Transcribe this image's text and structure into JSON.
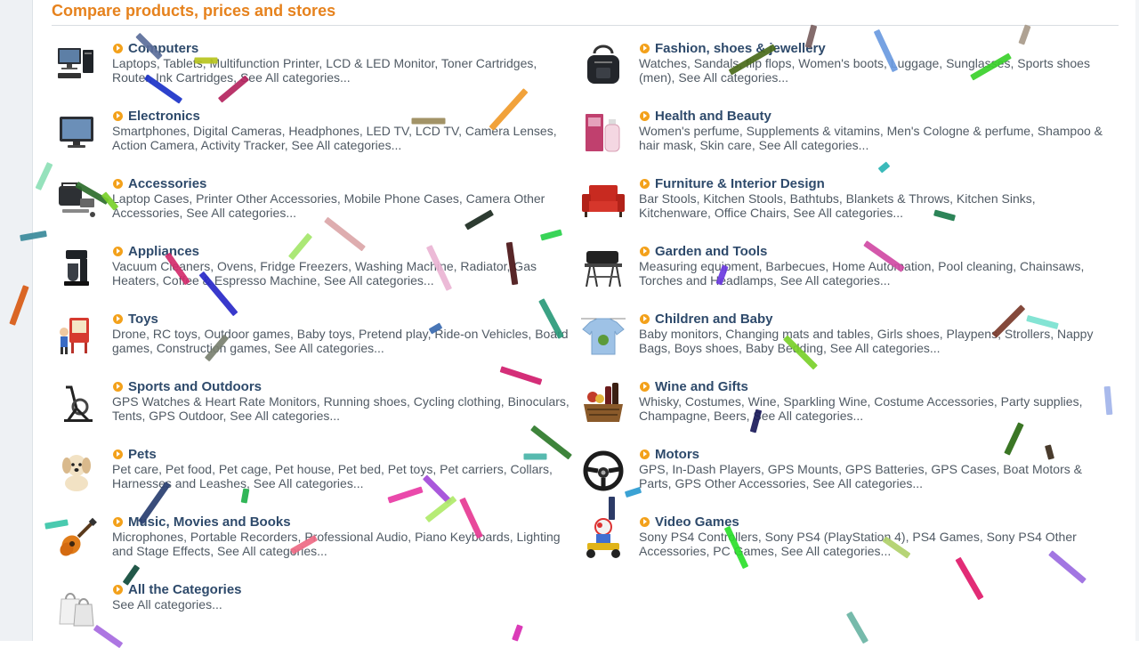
{
  "heading": "Compare products, prices and stores",
  "categories_left": [
    {
      "title": "Computers",
      "links": "Laptops, Tablets, Multifunction Printer, LCD & LED Monitor, Toner Cartridges, Router, Ink Cartridges, See All categories...",
      "icon": "computer-icon"
    },
    {
      "title": "Electronics",
      "links": "Smartphones, Digital Cameras, Headphones, LED TV, LCD TV, Camera Lenses, Action Camera, Activity Tracker, See All categories...",
      "icon": "tv-icon"
    },
    {
      "title": "Accessories",
      "links": "Laptop Cases, Printer Other Accessories, Mobile Phone Cases, Camera Other Accessories, See All categories...",
      "icon": "bag-accessories-icon"
    },
    {
      "title": "Appliances",
      "links": "Vacuum Cleaners, Ovens, Fridge Freezers, Washing Machine, Radiator, Gas Heaters, Coffee & Espresso Machine, See All categories...",
      "icon": "coffee-maker-icon"
    },
    {
      "title": "Toys",
      "links": "Drone, RC toys, Outdoor games, Baby toys, Pretend play, Ride-on Vehicles, Board games, Construction games, See All categories...",
      "icon": "toy-easel-icon"
    },
    {
      "title": "Sports and Outdoors",
      "links": "GPS Watches & Heart Rate Monitors, Running shoes, Cycling clothing, Binoculars, Tents, GPS Outdoor, See All categories...",
      "icon": "exercise-bike-icon"
    },
    {
      "title": "Pets",
      "links": "Pet care, Pet food, Pet cage, Pet house, Pet bed, Pet toys, Pet carriers, Collars, Harnesses and Leashes, See All categories...",
      "icon": "puppy-icon"
    },
    {
      "title": "Music, Movies and Books",
      "links": "Microphones, Portable Recorders, Professional Audio, Piano Keyboards, Lighting and Stage Effects, See All categories...",
      "icon": "guitar-icon"
    },
    {
      "title": "All the Categories",
      "links": "See All categories...",
      "icon": "shopping-bags-icon"
    }
  ],
  "categories_right": [
    {
      "title": "Fashion, shoes & jewellery",
      "links": "Watches, Sandals, flip flops, Women's boots, Luggage, Sunglasses, Sports shoes (men), See All categories...",
      "icon": "backpack-icon"
    },
    {
      "title": "Health and Beauty",
      "links": "Women's perfume, Supplements & vitamins, Men's Cologne & perfume, Shampoo & hair mask, Skin care, See All categories...",
      "icon": "perfume-icon"
    },
    {
      "title": "Furniture & Interior Design",
      "links": "Bar Stools, Kitchen Stools, Bathtubs, Blankets & Throws, Kitchen Sinks, Kitchenware, Office Chairs, See All categories...",
      "icon": "armchair-icon"
    },
    {
      "title": "Garden and Tools",
      "links": "Measuring equipment, Barbecues, Home Automation, Pool cleaning, Chainsaws, Torches and Headlamps, See All categories...",
      "icon": "barbecue-icon"
    },
    {
      "title": "Children and Baby",
      "links": "Baby monitors, Changing mats and tables, Girls shoes, Playpens, Strollers, Nappy Bags, Boys shoes, Baby Bedding, See All categories...",
      "icon": "baby-shirt-icon"
    },
    {
      "title": "Wine and Gifts",
      "links": "Whisky, Costumes, Wine, Sparkling Wine, Costume Accessories, Party supplies, Champagne, Beers, See All categories...",
      "icon": "gift-basket-icon"
    },
    {
      "title": "Motors",
      "links": "GPS, In-Dash Players, GPS Mounts, GPS Batteries, GPS Cases, Boat Motors & Parts, GPS Other Accessories, See All categories...",
      "icon": "steering-wheel-icon"
    },
    {
      "title": "Video Games",
      "links": "Sony PS4 Controllers, Sony PS4 (PlayStation 4), PS4 Games, Sony PS4 Other Accessories, PC Games, See All categories...",
      "icon": "kart-racer-icon"
    }
  ],
  "colors": {
    "heading": "#e6821d",
    "title": "#2e4a6b",
    "links": "#505a64",
    "bullet": "#f3a11b"
  }
}
